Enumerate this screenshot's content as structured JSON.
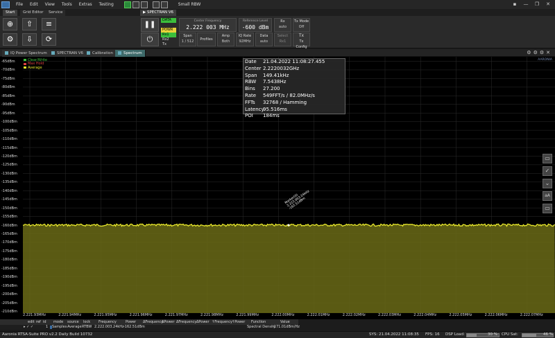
{
  "menubar": {
    "items": [
      "File",
      "Edit",
      "View",
      "Tools",
      "Extras",
      "Testing"
    ],
    "title": "Small RBW"
  },
  "ribbon_tabs": [
    "Start",
    "Grid Editor",
    "Service"
  ],
  "device_tab": "SPECTRAN V6",
  "ribbon": {
    "indicators": [
      {
        "label": "DATA",
        "color": "#3cbf3c"
      },
      {
        "label": "POWR",
        "color": "#e8d23a"
      },
      {
        "label": "Rx1",
        "color": "#3cbf3c"
      },
      {
        "label": "Rx2",
        "color": "#2a2a2a"
      },
      {
        "label": "Tx",
        "color": "#2a2a2a"
      }
    ],
    "span": {
      "label": "Span",
      "value": "1 / 512"
    },
    "profiles": {
      "label": "Profiles"
    },
    "amp": {
      "label": "Amp",
      "value": "Both"
    },
    "iq_rate": {
      "label": "IQ Rate",
      "value": "92MHz"
    },
    "data": {
      "label": "Data",
      "value": "auto"
    },
    "center_frequency": {
      "label": "Center Frequency",
      "value": "2.222 003 MHz"
    },
    "reference_level": {
      "label": "Reference Level",
      "value": "-600 dBm"
    },
    "rx": {
      "label": "Rx",
      "value": "auto"
    },
    "select": {
      "label": "Select",
      "value": "Rx1"
    },
    "tx_mode": {
      "label": "Tx Mode",
      "value": "Off"
    },
    "tx_config": {
      "label": "Tx Config"
    }
  },
  "doc_tabs": [
    "IQ Power Spectrum",
    "SPECTRAN V6",
    "Calibration",
    "Spectrum"
  ],
  "y_axis": [
    "-65dBm",
    "-70dBm",
    "-75dBm",
    "-80dBm",
    "-85dBm",
    "-90dBm",
    "-95dBm",
    "-100dBm",
    "-105dBm",
    "-110dBm",
    "-115dBm",
    "-120dBm",
    "-125dBm",
    "-130dBm",
    "-135dBm",
    "-140dBm",
    "-145dBm",
    "-150dBm",
    "-155dBm",
    "-160dBm",
    "-165dBm",
    "-170dBm",
    "-175dBm",
    "-180dBm",
    "-185dBm",
    "-190dBm",
    "-195dBm",
    "-200dBm",
    "-205dBm",
    "-210dBm"
  ],
  "x_axis": [
    "2.221.93MHz",
    "2.221.94MHz",
    "2.221.95MHz",
    "2.221.96MHz",
    "2.221.97MHz",
    "2.221.98MHz",
    "2.221.99MHz",
    "2.222.00MHz",
    "2.222.01MHz",
    "2.222.02MHz",
    "2.222.03MHz",
    "2.222.04MHz",
    "2.222.05MHz",
    "2.222.06MHz",
    "2.222.07MHz"
  ],
  "legend": [
    {
      "label": "Clear/Write",
      "color": "#3cbf3c"
    },
    {
      "label": "Max Hold",
      "color": "#e04040"
    },
    {
      "label": "Average",
      "color": "#e8e82a"
    }
  ],
  "info": [
    {
      "k": "Date",
      "v": "21.04.2022 11:08:27.455"
    },
    {
      "k": "Center",
      "v": "2.2220032GHz"
    },
    {
      "k": "Span",
      "v": "149.41kHz"
    },
    {
      "k": "RBW",
      "v": "7.5438Hz"
    },
    {
      "k": "Bins",
      "v": "27.200"
    },
    {
      "k": "Rate",
      "v": "549FFT/s / 82.0MHz/s"
    },
    {
      "k": "FFTs",
      "v": "32768 / Hamming"
    },
    {
      "k": "Latency",
      "v": "95.516ms"
    },
    {
      "k": "POI",
      "v": "184ms"
    }
  ],
  "marker": {
    "label": "Marker(0)",
    "freq": "2.222.003.24kHz",
    "level": "-162.51dBm"
  },
  "chart_data": {
    "type": "area",
    "ylim": [
      -212,
      -63
    ],
    "xlim": [
      "2.221.93MHz",
      "2.222.07MHz"
    ],
    "series": [
      {
        "name": "Average",
        "level_dbm": -162.5,
        "color": "#e8e82a"
      }
    ]
  },
  "marker_table": {
    "headers": [
      "edit",
      "ref",
      "id",
      "mode",
      "source",
      "lock",
      "Frequency",
      "Power",
      "ΔFrequency",
      "ΔPower",
      "ΔFrequency",
      "ΔPower",
      "↑Frequency",
      "↑Power",
      "Function",
      "Value"
    ],
    "row": {
      "id": "1",
      "mode": "Samples",
      "source": "Average",
      "lock": "RTBW",
      "frequency": "2.222.003.24kHz",
      "power": "-162.51dBm",
      "function": "Spectral Density",
      "value": "-171.01dBm/Hz"
    }
  },
  "status": {
    "app": "Aaronia RTSA-Suite PRO v2.2 Daily Build 10732",
    "sys": "SYS:  21.04.2022 11:08:35",
    "fps": "FPS:  16",
    "dsp": "DSP Load:",
    "dsp_value": "30 %",
    "dsp_fraction": 0.3,
    "cpu": "CPU Sat:",
    "cpu_value": "46 %",
    "cpu_fraction": 0.46
  }
}
